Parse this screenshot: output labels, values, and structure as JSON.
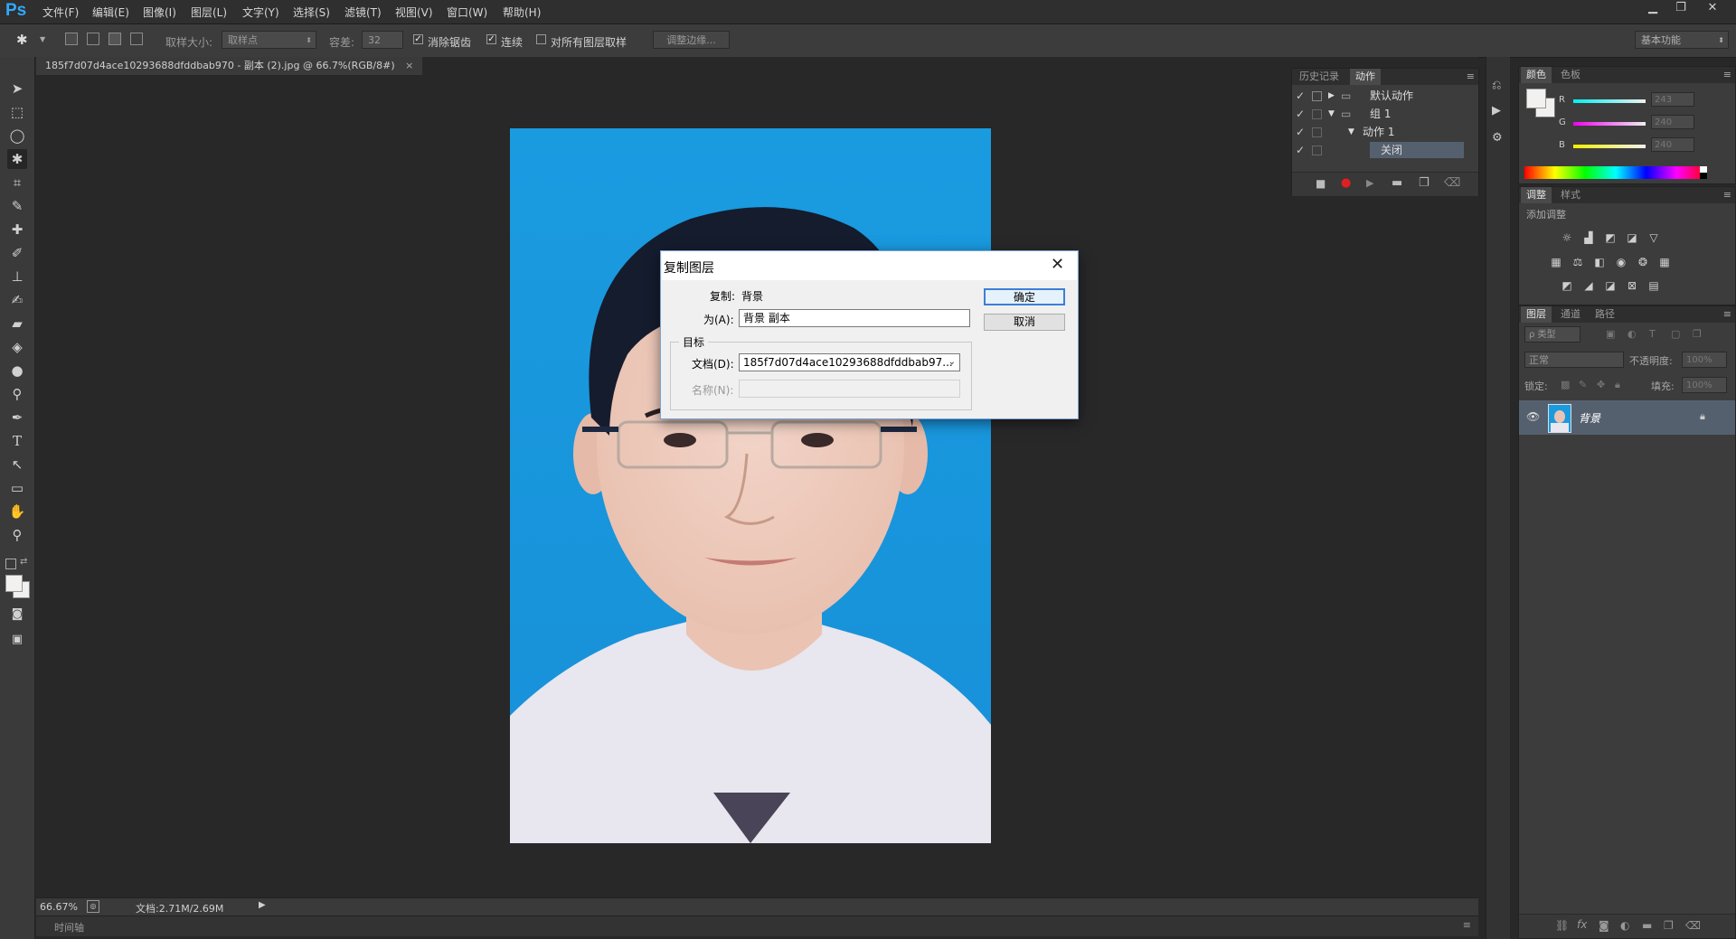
{
  "app": {
    "logo": "Ps",
    "menu": [
      "文件(F)",
      "编辑(E)",
      "图像(I)",
      "图层(L)",
      "文字(Y)",
      "选择(S)",
      "滤镜(T)",
      "视图(V)",
      "窗口(W)",
      "帮助(H)"
    ],
    "window_controls": [
      "minimize-icon",
      "restore-icon",
      "close-icon"
    ]
  },
  "options": {
    "sample_size_label": "取样大小:",
    "sample_size_value": "取样点",
    "tolerance_label": "容差:",
    "tolerance_value": "32",
    "antialias_label": "消除锯齿",
    "antialias_checked": true,
    "contiguous_label": "连续",
    "contiguous_checked": true,
    "all_layers_label": "对所有图层取样",
    "all_layers_checked": false,
    "refine_edge_label": "调整边缘...",
    "workspace": "基本功能"
  },
  "document": {
    "tab_title": "185f7d07d4ace10293688dfddbab970 - 副本 (2).jpg @ 66.7%(RGB/8#)",
    "tab_close": "×",
    "zoom": "66.67%",
    "doc_size": "文档:2.71M/2.69M",
    "timeline_label": "时间轴"
  },
  "actions_panel": {
    "tabs": [
      "历史记录",
      "动作"
    ],
    "active_tab": "动作",
    "rows": [
      {
        "label": "默认动作",
        "level": 0,
        "type": "folder",
        "expanded": false
      },
      {
        "label": "组 1",
        "level": 0,
        "type": "folder",
        "expanded": true
      },
      {
        "label": "动作 1",
        "level": 1,
        "type": "action",
        "expanded": true
      },
      {
        "label": "关闭",
        "level": 2,
        "type": "step",
        "selected": true
      }
    ],
    "toolbar_icons": [
      "stop-icon",
      "record-icon",
      "play-icon",
      "new-set-icon",
      "new-action-icon",
      "delete-icon"
    ]
  },
  "color_panel": {
    "tabs": [
      "颜色",
      "色板"
    ],
    "channels": [
      {
        "name": "R",
        "value": "243",
        "color": "#39d0e0"
      },
      {
        "name": "G",
        "value": "240",
        "color": "#e040d0"
      },
      {
        "name": "B",
        "value": "240",
        "color": "#e8e030"
      }
    ]
  },
  "adjustments_panel": {
    "tabs": [
      "调整",
      "样式"
    ],
    "subtitle": "添加调整"
  },
  "layers_panel": {
    "tabs": [
      "图层",
      "通道",
      "路径"
    ],
    "filter_label": "ρ 类型",
    "blend_mode": "正常",
    "opacity_label": "不透明度:",
    "opacity_value": "100%",
    "lock_label": "锁定:",
    "fill_label": "填充:",
    "fill_value": "100%",
    "layers": [
      {
        "name": "背景",
        "visible": true,
        "locked": true
      }
    ]
  },
  "dialog": {
    "title": "复制图层",
    "duplicate_label": "复制:",
    "duplicate_value": "背景",
    "as_label": "为(A):",
    "as_value": "背景 副本",
    "target_group": "目标",
    "document_label": "文档(D):",
    "document_value": "185f7d07d4ace10293688dfddbab97...",
    "name_label": "名称(N):",
    "name_value": "",
    "ok_label": "确定",
    "cancel_label": "取消"
  }
}
